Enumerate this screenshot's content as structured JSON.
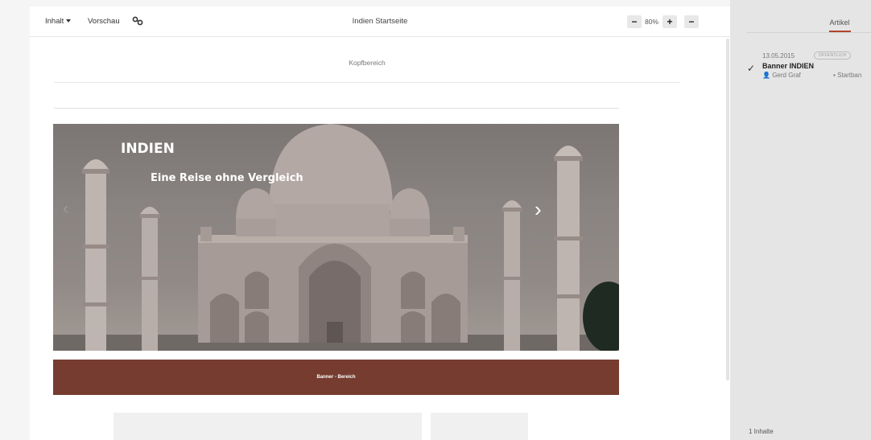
{
  "toolbar": {
    "content_menu": "Inhalt",
    "preview": "Vorschau",
    "link_icon": "link-icon",
    "page_title": "Indien Startseite",
    "zoom_out": "−",
    "zoom_value": "80%",
    "zoom_in": "+",
    "collapse": "−"
  },
  "page": {
    "header_area": "Kopfbereich",
    "banner_title": "INDIEN",
    "banner_subtitle": "Eine Reise ohne Vergleich",
    "banner_next": "›",
    "banner_prev": "‹",
    "banner_area": "Banner - Bereich"
  },
  "side_panel": {
    "tab_articles": "Artikel",
    "article": {
      "date": "13.05.2015",
      "status": "ÖFFENTLICH",
      "title": "Banner INDIEN",
      "author": "Gerd Graf",
      "page": "Startban"
    },
    "count": "1 Inhalte"
  },
  "colors": {
    "accent": "#b0452a",
    "banner_bar": "#763c2f"
  }
}
